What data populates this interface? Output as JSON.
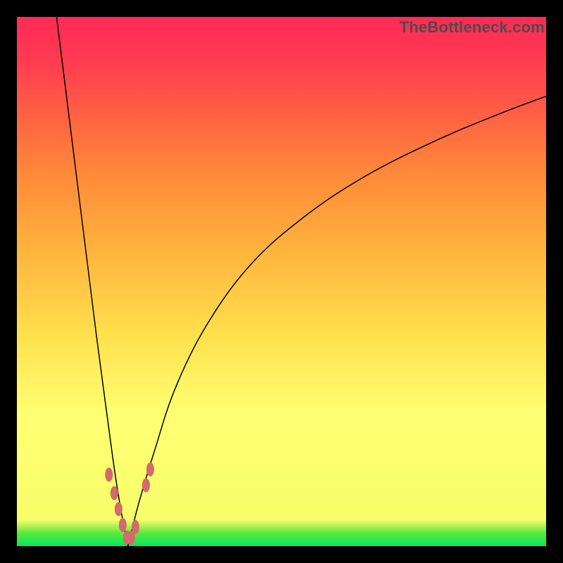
{
  "brand": {
    "label": "TheBottleneck.com"
  },
  "chart_data": {
    "type": "line",
    "title": "",
    "xlabel": "",
    "ylabel": "",
    "xlim": [
      0,
      100
    ],
    "ylim": [
      0,
      100
    ],
    "series": [
      {
        "name": "left-descending",
        "x": [
          7.5,
          10,
          12.5,
          15,
          17,
          18.5,
          19.8,
          21
        ],
        "values": [
          100,
          80,
          60,
          40,
          25,
          14,
          6,
          0
        ]
      },
      {
        "name": "right-rising",
        "x": [
          21,
          23,
          26,
          30,
          36,
          44,
          54,
          66,
          80,
          92,
          100
        ],
        "values": [
          0,
          8,
          18,
          30,
          42,
          53,
          62,
          70,
          77,
          82,
          85
        ]
      }
    ],
    "markers": {
      "name": "highlight-markers",
      "color": "#d46a6a",
      "points": [
        {
          "x": 17.4,
          "y": 13.5
        },
        {
          "x": 18.4,
          "y": 10.0
        },
        {
          "x": 19.2,
          "y": 7.0
        },
        {
          "x": 20.0,
          "y": 4.0
        },
        {
          "x": 20.8,
          "y": 1.6
        },
        {
          "x": 21.6,
          "y": 1.6
        },
        {
          "x": 22.4,
          "y": 3.6
        },
        {
          "x": 24.4,
          "y": 11.5
        },
        {
          "x": 25.2,
          "y": 14.5
        }
      ]
    },
    "background_gradient": {
      "top": "#ff2a55",
      "middle": "#ffff73",
      "bottom": "#00e85f"
    }
  }
}
